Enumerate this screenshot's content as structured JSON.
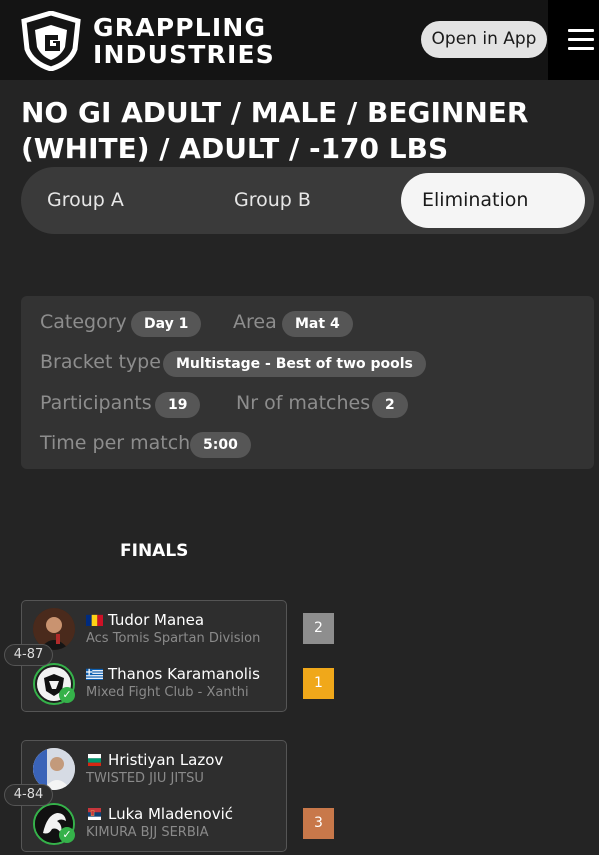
{
  "header": {
    "logo_line1": "GRAPPLING",
    "logo_line2": "INDUSTRIES",
    "open_app": "Open in App",
    "menu_icon": "hamburger-menu-icon"
  },
  "title": "NO GI ADULT / MALE / BEGINNER (WHITE) / ADULT / -170 LBS",
  "tabs": [
    {
      "label": "Group A",
      "active": false
    },
    {
      "label": "Group B",
      "active": false
    },
    {
      "label": "Elimination",
      "active": true
    }
  ],
  "info": {
    "category_label": "Category",
    "category_value": "Day 1",
    "area_label": "Area",
    "area_value": "Mat 4",
    "bracket_label": "Bracket type",
    "bracket_value": "Multistage - Best of two pools",
    "participants_label": "Participants",
    "participants_value": "19",
    "matches_label": "Nr of matches",
    "matches_value": "2",
    "time_label": "Time per match",
    "time_value": "5:00"
  },
  "section_title": "FINALS",
  "matches": [
    {
      "number": "4-87",
      "fighters": [
        {
          "name": "Tudor Manea",
          "club": "Acs Tomis Spartan Division",
          "flag": "romania-flag-icon",
          "winner": false,
          "place": "2",
          "place_color": "#8e8e8e"
        },
        {
          "name": "Thanos Karamanolis",
          "club": "Mixed Fight Club - Xanthi",
          "flag": "greece-flag-icon",
          "winner": true,
          "place": "1",
          "place_color": "#f0a81a"
        }
      ]
    },
    {
      "number": "4-84",
      "fighters": [
        {
          "name": "Hristiyan Lazov",
          "club": "TWISTED JIU JITSU",
          "flag": "bulgaria-flag-icon",
          "winner": false,
          "place": "",
          "place_color": ""
        },
        {
          "name": "Luka Mladenović",
          "club": "KIMURA BJJ SERBIA",
          "flag": "serbia-flag-icon",
          "winner": true,
          "place": "3",
          "place_color": "#c8784a"
        }
      ]
    }
  ],
  "colors": {
    "background": "#242424",
    "header": "#141414",
    "panel": "#333333",
    "pill": "#565656",
    "winner_check": "#35b24a"
  }
}
